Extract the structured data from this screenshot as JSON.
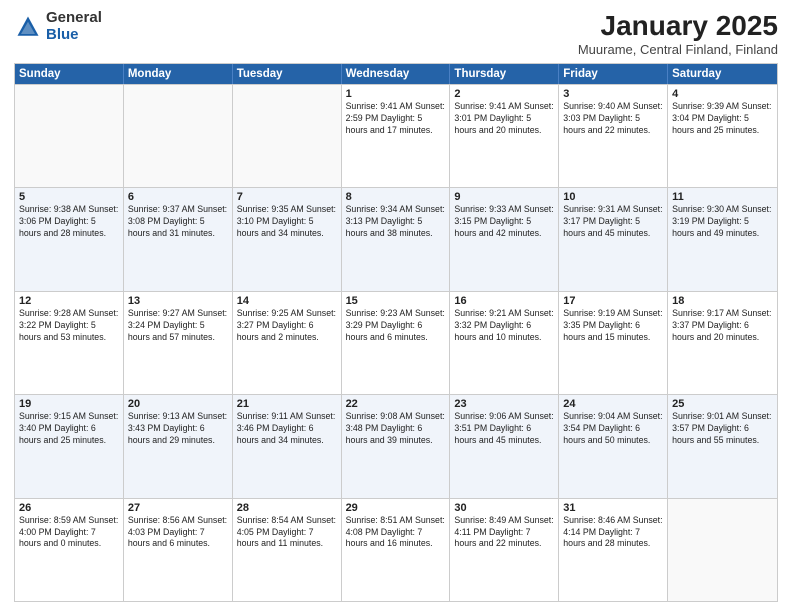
{
  "logo": {
    "general": "General",
    "blue": "Blue"
  },
  "header": {
    "month": "January 2025",
    "location": "Muurame, Central Finland, Finland"
  },
  "weekdays": [
    "Sunday",
    "Monday",
    "Tuesday",
    "Wednesday",
    "Thursday",
    "Friday",
    "Saturday"
  ],
  "weeks": [
    [
      {
        "day": "",
        "info": ""
      },
      {
        "day": "",
        "info": ""
      },
      {
        "day": "",
        "info": ""
      },
      {
        "day": "1",
        "info": "Sunrise: 9:41 AM\nSunset: 2:59 PM\nDaylight: 5 hours and 17 minutes."
      },
      {
        "day": "2",
        "info": "Sunrise: 9:41 AM\nSunset: 3:01 PM\nDaylight: 5 hours and 20 minutes."
      },
      {
        "day": "3",
        "info": "Sunrise: 9:40 AM\nSunset: 3:03 PM\nDaylight: 5 hours and 22 minutes."
      },
      {
        "day": "4",
        "info": "Sunrise: 9:39 AM\nSunset: 3:04 PM\nDaylight: 5 hours and 25 minutes."
      }
    ],
    [
      {
        "day": "5",
        "info": "Sunrise: 9:38 AM\nSunset: 3:06 PM\nDaylight: 5 hours and 28 minutes."
      },
      {
        "day": "6",
        "info": "Sunrise: 9:37 AM\nSunset: 3:08 PM\nDaylight: 5 hours and 31 minutes."
      },
      {
        "day": "7",
        "info": "Sunrise: 9:35 AM\nSunset: 3:10 PM\nDaylight: 5 hours and 34 minutes."
      },
      {
        "day": "8",
        "info": "Sunrise: 9:34 AM\nSunset: 3:13 PM\nDaylight: 5 hours and 38 minutes."
      },
      {
        "day": "9",
        "info": "Sunrise: 9:33 AM\nSunset: 3:15 PM\nDaylight: 5 hours and 42 minutes."
      },
      {
        "day": "10",
        "info": "Sunrise: 9:31 AM\nSunset: 3:17 PM\nDaylight: 5 hours and 45 minutes."
      },
      {
        "day": "11",
        "info": "Sunrise: 9:30 AM\nSunset: 3:19 PM\nDaylight: 5 hours and 49 minutes."
      }
    ],
    [
      {
        "day": "12",
        "info": "Sunrise: 9:28 AM\nSunset: 3:22 PM\nDaylight: 5 hours and 53 minutes."
      },
      {
        "day": "13",
        "info": "Sunrise: 9:27 AM\nSunset: 3:24 PM\nDaylight: 5 hours and 57 minutes."
      },
      {
        "day": "14",
        "info": "Sunrise: 9:25 AM\nSunset: 3:27 PM\nDaylight: 6 hours and 2 minutes."
      },
      {
        "day": "15",
        "info": "Sunrise: 9:23 AM\nSunset: 3:29 PM\nDaylight: 6 hours and 6 minutes."
      },
      {
        "day": "16",
        "info": "Sunrise: 9:21 AM\nSunset: 3:32 PM\nDaylight: 6 hours and 10 minutes."
      },
      {
        "day": "17",
        "info": "Sunrise: 9:19 AM\nSunset: 3:35 PM\nDaylight: 6 hours and 15 minutes."
      },
      {
        "day": "18",
        "info": "Sunrise: 9:17 AM\nSunset: 3:37 PM\nDaylight: 6 hours and 20 minutes."
      }
    ],
    [
      {
        "day": "19",
        "info": "Sunrise: 9:15 AM\nSunset: 3:40 PM\nDaylight: 6 hours and 25 minutes."
      },
      {
        "day": "20",
        "info": "Sunrise: 9:13 AM\nSunset: 3:43 PM\nDaylight: 6 hours and 29 minutes."
      },
      {
        "day": "21",
        "info": "Sunrise: 9:11 AM\nSunset: 3:46 PM\nDaylight: 6 hours and 34 minutes."
      },
      {
        "day": "22",
        "info": "Sunrise: 9:08 AM\nSunset: 3:48 PM\nDaylight: 6 hours and 39 minutes."
      },
      {
        "day": "23",
        "info": "Sunrise: 9:06 AM\nSunset: 3:51 PM\nDaylight: 6 hours and 45 minutes."
      },
      {
        "day": "24",
        "info": "Sunrise: 9:04 AM\nSunset: 3:54 PM\nDaylight: 6 hours and 50 minutes."
      },
      {
        "day": "25",
        "info": "Sunrise: 9:01 AM\nSunset: 3:57 PM\nDaylight: 6 hours and 55 minutes."
      }
    ],
    [
      {
        "day": "26",
        "info": "Sunrise: 8:59 AM\nSunset: 4:00 PM\nDaylight: 7 hours and 0 minutes."
      },
      {
        "day": "27",
        "info": "Sunrise: 8:56 AM\nSunset: 4:03 PM\nDaylight: 7 hours and 6 minutes."
      },
      {
        "day": "28",
        "info": "Sunrise: 8:54 AM\nSunset: 4:05 PM\nDaylight: 7 hours and 11 minutes."
      },
      {
        "day": "29",
        "info": "Sunrise: 8:51 AM\nSunset: 4:08 PM\nDaylight: 7 hours and 16 minutes."
      },
      {
        "day": "30",
        "info": "Sunrise: 8:49 AM\nSunset: 4:11 PM\nDaylight: 7 hours and 22 minutes."
      },
      {
        "day": "31",
        "info": "Sunrise: 8:46 AM\nSunset: 4:14 PM\nDaylight: 7 hours and 28 minutes."
      },
      {
        "day": "",
        "info": ""
      }
    ]
  ]
}
